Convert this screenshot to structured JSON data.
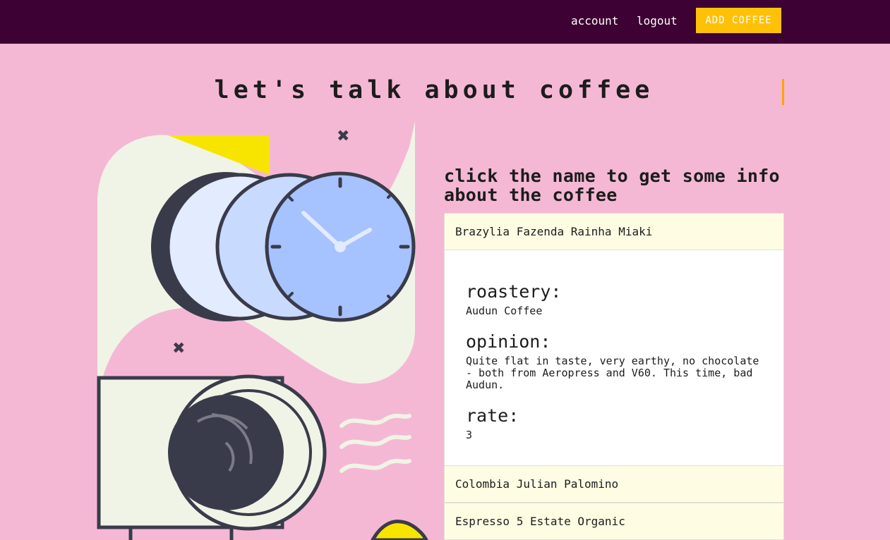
{
  "nav": {
    "account": "account",
    "logout": "logout",
    "add_coffee": "ADD COFFEE"
  },
  "hero": {
    "title": "let's talk about coffee"
  },
  "panel": {
    "heading": "click the name to get some info about the coffee",
    "coffees": [
      {
        "name": "Brazylia Fazenda Rainha Miaki",
        "expanded": true,
        "roastery_label": "roastery:",
        "roastery": "Audun Coffee",
        "opinion_label": "opinion:",
        "opinion": "Quite flat in taste, very earthy, no chocolate - both from Aeropress and V60. This time, bad Audun.",
        "rate_label": "rate:",
        "rate": "3"
      },
      {
        "name": "Colombia Julian Palomino"
      },
      {
        "name": "Espresso 5 Estate Organic"
      }
    ]
  },
  "colors": {
    "background": "#f4b8d4",
    "topbar": "#3d0133",
    "accent": "#ffc107",
    "list_item": "#fefde4"
  },
  "icons": [
    "close-mark-icon",
    "clock-icon",
    "coffee-machine-icon",
    "wave-icon"
  ]
}
